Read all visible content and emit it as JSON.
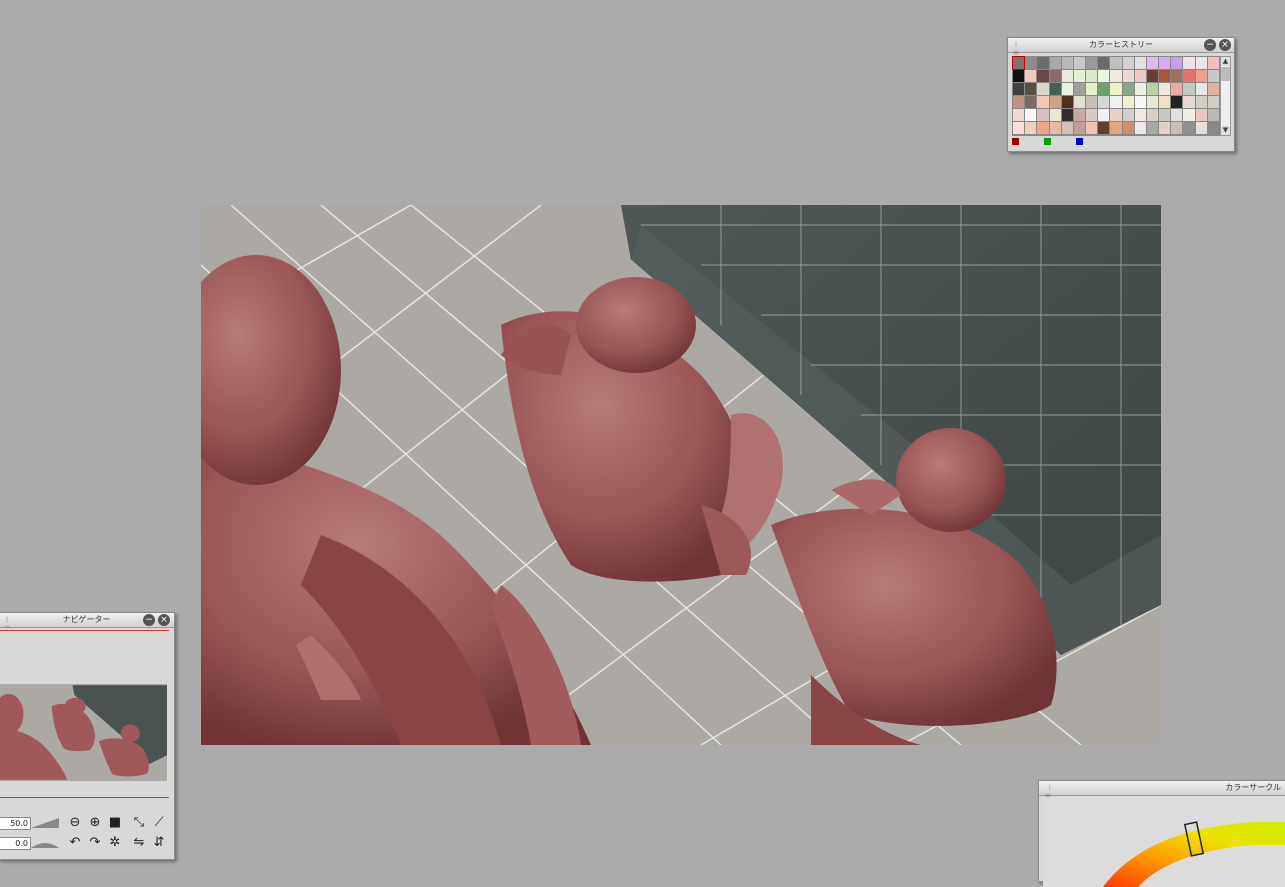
{
  "history_panel": {
    "title": "カラーヒストリー",
    "swatches": [
      "#8a6e6e",
      "#8c8c8c",
      "#6e6e6e",
      "#a8a8a8",
      "#b8b8b8",
      "#c8c8c8",
      "#9a9a9a",
      "#6a6a6a",
      "#c0c0c0",
      "#d0d0d0",
      "#e0e0e0",
      "#e0b8f0",
      "#d8a8f0",
      "#c8a0e8",
      "#f0e0e8",
      "#e8e8e8",
      "#f0c0c0",
      "#101010",
      "#f0c8c0",
      "#6a4848",
      "#8a6a6a",
      "#e8e8e0",
      "#e0f0d0",
      "#d8e8c8",
      "#e8f8e0",
      "#f0e8e0",
      "#e8d8d0",
      "#f0c8c8",
      "#684030",
      "#a85838",
      "#a07060",
      "#e87070",
      "#f0a090",
      "#c8c8c8",
      "#404040",
      "#585040",
      "#d8d8c8",
      "#486058",
      "#e8f0e0",
      "#a0a0a0",
      "#e8f0c8",
      "#70a070",
      "#f0f0c0",
      "#88a888",
      "#f0f0e0",
      "#b8d0a8",
      "#e8e8e0",
      "#f0a8a0",
      "#c0c8c0",
      "#e8e8e8",
      "#e0b0a0",
      "#c09080",
      "#806860",
      "#f0c8b8",
      "#d0a088",
      "#503020",
      "#e0e0d0",
      "#c8c0b8",
      "#d8d8d8",
      "#f0f0f0",
      "#f0f0d0",
      "#f8f8f8",
      "#e8e8d8",
      "#f0e0c8",
      "#202020",
      "#e8d8d0",
      "#d0d0c8",
      "#d0d0c8",
      "#f0d8d0",
      "#f8f8f8",
      "#d8c0c0",
      "#e8e8d0",
      "#303030",
      "#c8a8a0",
      "#d8c8c8",
      "#f0f0f0",
      "#e8d0c8",
      "#d0d0d0",
      "#f0e8e0",
      "#d8d0c8",
      "#c8c8c0",
      "#e0e0e0",
      "#f0f0e8",
      "#e8c8c0",
      "#b8b8b8",
      "#f8e0e0",
      "#f0d0c0",
      "#e8a888",
      "#e8b8a8",
      "#d0c0b8",
      "#c0a098",
      "#f0c0b0",
      "#604030",
      "#e0a880",
      "#d09070",
      "#f0e8e8",
      "#a8a8a8",
      "#e0d0c8",
      "#c8c0b8",
      "#909090",
      "#e8e0d8"
    ],
    "current_colors": [
      "#a00000",
      "#00a000",
      "#0000c0"
    ],
    "scroll_up": "▲",
    "scroll_down": "▼"
  },
  "navigator_panel": {
    "title": "ナビゲーター",
    "zoom_value": "50.0",
    "rotate_value": "0.0",
    "icons": [
      "zoom-out",
      "zoom-in",
      "fit",
      "flip-h",
      "rotate-left",
      "rotate-right",
      "reset-rotate"
    ]
  },
  "circle_panel": {
    "title": "カラーサークル"
  },
  "colors": {
    "skin": "#a0585a",
    "floor": "#aca8a3",
    "box": "#4a5352",
    "grid": "#f0f0f0"
  }
}
